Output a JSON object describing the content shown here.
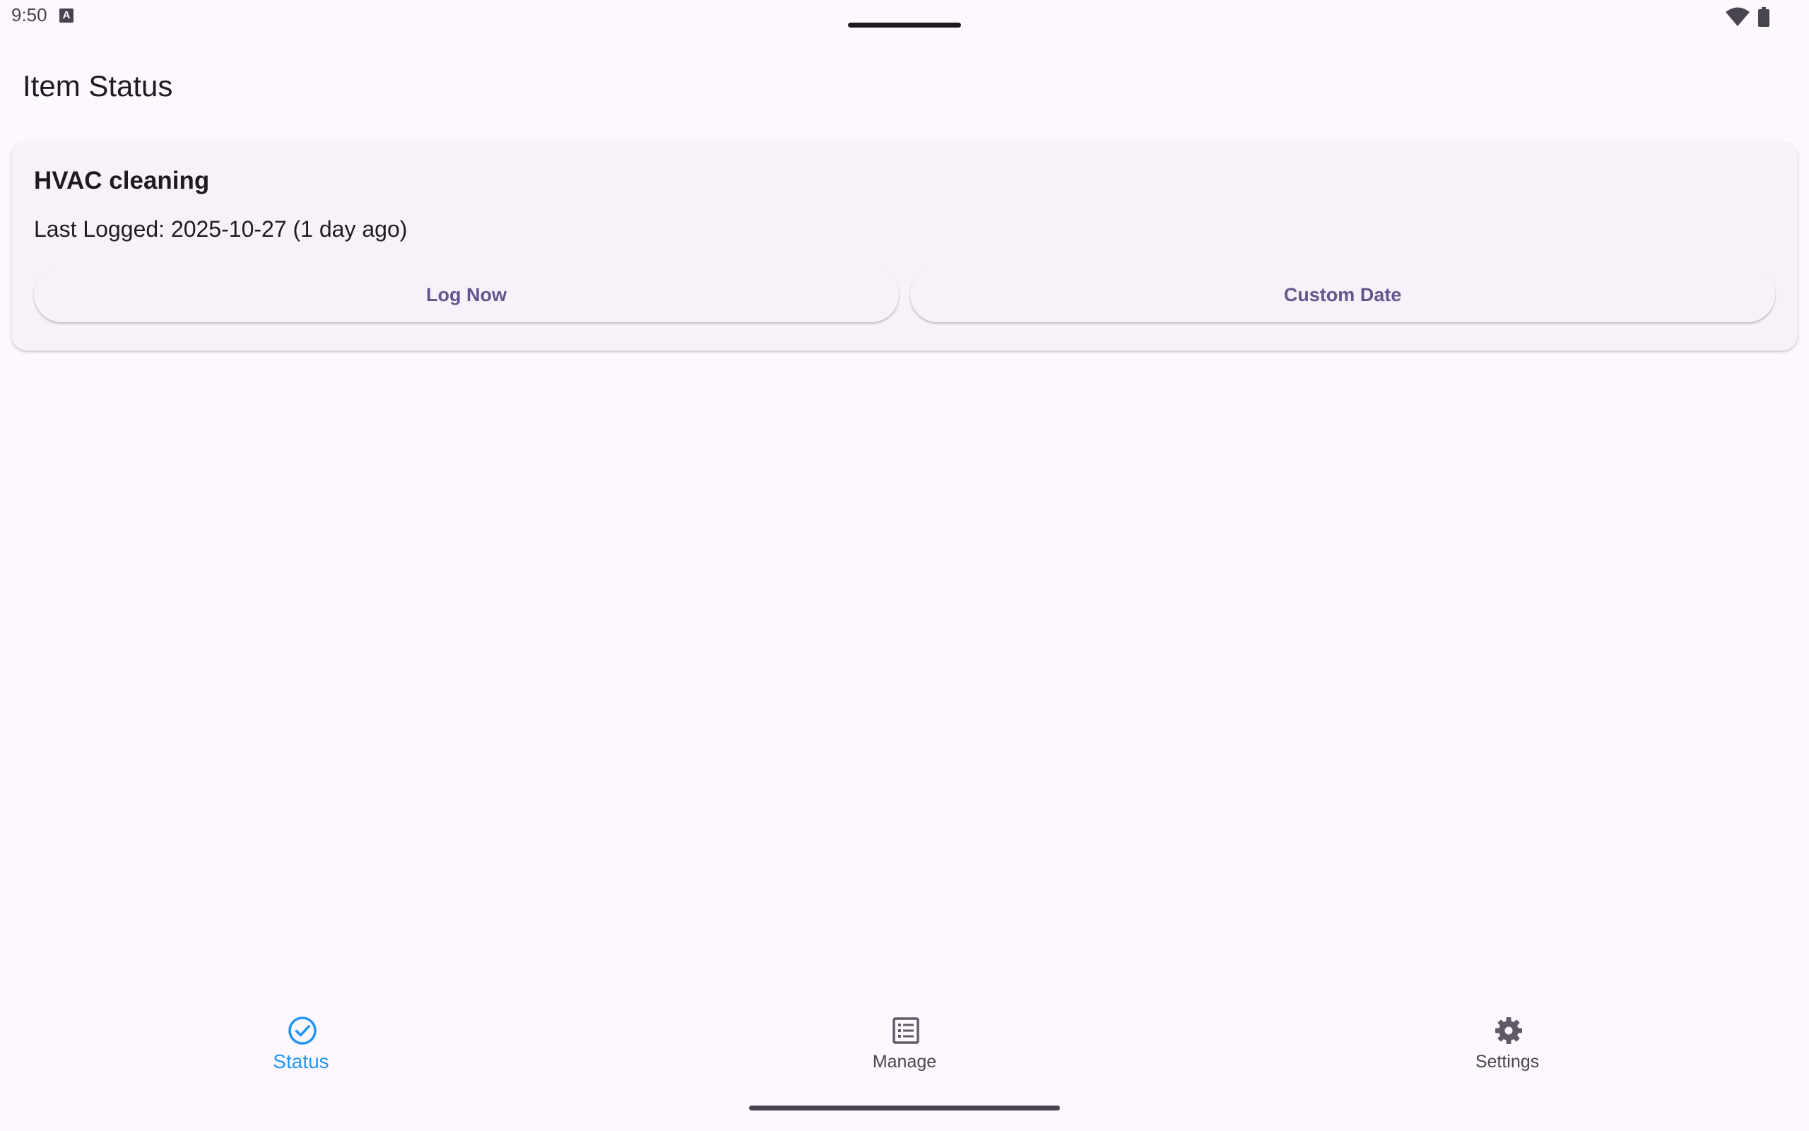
{
  "status_bar": {
    "time": "9:50",
    "notification_icon_letter": "A",
    "wifi_icon": "wifi-icon",
    "battery_icon": "battery-icon"
  },
  "app_bar": {
    "title": "Item Status"
  },
  "item_card": {
    "name": "HVAC cleaning",
    "last_logged": "Last Logged: 2025-10-27 (1 day ago)",
    "log_now_label": "Log Now",
    "custom_date_label": "Custom Date"
  },
  "bottom_nav": {
    "items": [
      {
        "label": "Status",
        "icon": "check-circle-icon",
        "selected": true
      },
      {
        "label": "Manage",
        "icon": "list-icon",
        "selected": false
      },
      {
        "label": "Settings",
        "icon": "gear-icon",
        "selected": false
      }
    ]
  },
  "colors": {
    "background": "#fef7ff",
    "card": "#f7f2fa",
    "button_text": "#65558f",
    "nav_selected": "#2196f3",
    "nav_unselected": "#49454f"
  }
}
